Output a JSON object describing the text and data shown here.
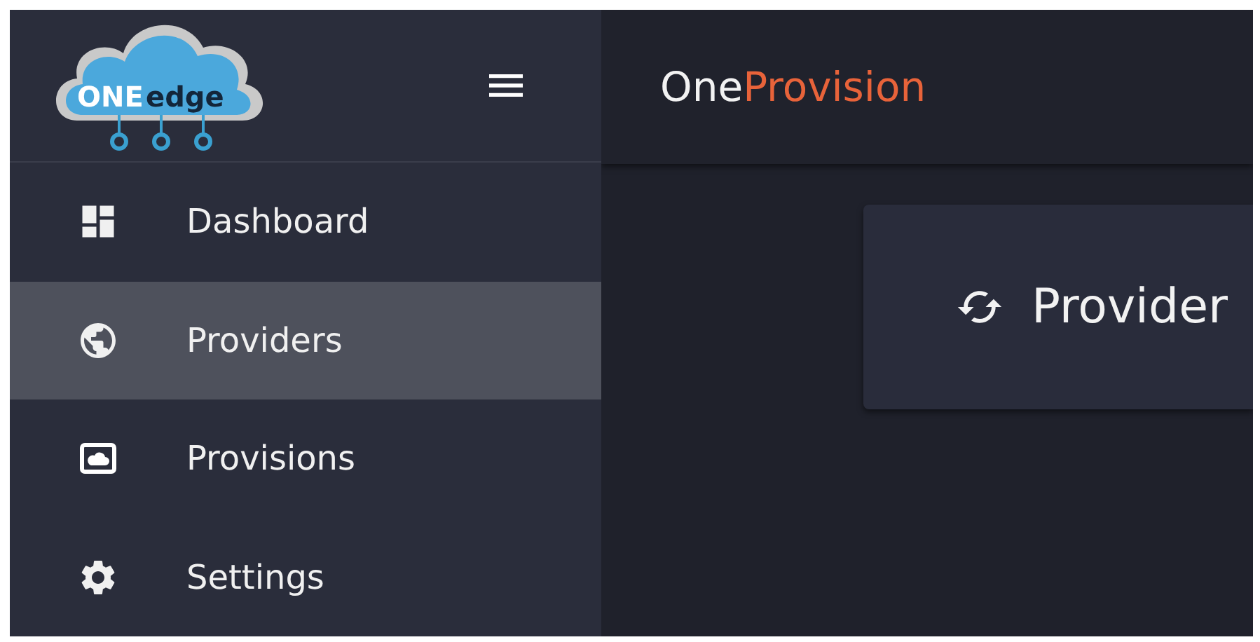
{
  "logo": {
    "word_1": "ONE",
    "word_2": "edge"
  },
  "header": {
    "title_part_1": "One",
    "title_part_2": "Provision"
  },
  "sidebar": {
    "items": [
      {
        "label": "Dashboard",
        "kind": "dashboard",
        "selected": false
      },
      {
        "label": "Providers",
        "kind": "globe",
        "selected": true
      },
      {
        "label": "Provisions",
        "kind": "cloud",
        "selected": false
      },
      {
        "label": "Settings",
        "kind": "gear",
        "selected": false
      }
    ]
  },
  "card": {
    "title": "Provider"
  }
}
